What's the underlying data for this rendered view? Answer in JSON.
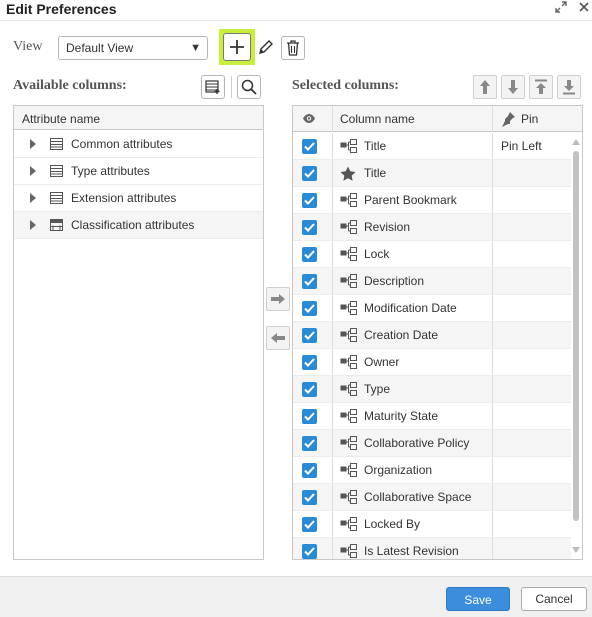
{
  "dialog": {
    "title": "Edit Preferences",
    "expand_icon": "expand-icon",
    "close_icon": "close-icon"
  },
  "view": {
    "label": "View",
    "selected": "Default View",
    "buttons": [
      "add-icon",
      "pencil-icon",
      "trash-icon"
    ]
  },
  "available": {
    "label": "Available columns:",
    "header": "Attribute name",
    "items": [
      {
        "label": "Common attributes",
        "icon": "list-icon"
      },
      {
        "label": "Type attributes",
        "icon": "list-icon"
      },
      {
        "label": "Extension attributes",
        "icon": "list-icon"
      },
      {
        "label": "Classification attributes",
        "icon": "classification-icon"
      }
    ]
  },
  "selected": {
    "label": "Selected columns:",
    "headers": {
      "visible": "eye-icon",
      "column_name": "Column name",
      "pin": "Pin"
    },
    "rows": [
      {
        "name": "Title",
        "icon": "attribute-icon",
        "pin": "Pin Left",
        "checked": true
      },
      {
        "name": "Title",
        "icon": "star-icon",
        "pin": "",
        "checked": true
      },
      {
        "name": "Parent Bookmark",
        "icon": "attribute-icon",
        "pin": "",
        "checked": true
      },
      {
        "name": "Revision",
        "icon": "attribute-icon",
        "pin": "",
        "checked": true
      },
      {
        "name": "Lock",
        "icon": "attribute-icon",
        "pin": "",
        "checked": true
      },
      {
        "name": "Description",
        "icon": "attribute-icon",
        "pin": "",
        "checked": true
      },
      {
        "name": "Modification Date",
        "icon": "attribute-icon",
        "pin": "",
        "checked": true
      },
      {
        "name": "Creation Date",
        "icon": "attribute-icon",
        "pin": "",
        "checked": true
      },
      {
        "name": "Owner",
        "icon": "attribute-icon",
        "pin": "",
        "checked": true
      },
      {
        "name": "Type",
        "icon": "attribute-icon",
        "pin": "",
        "checked": true
      },
      {
        "name": "Maturity State",
        "icon": "attribute-icon",
        "pin": "",
        "checked": true
      },
      {
        "name": "Collaborative Policy",
        "icon": "attribute-icon",
        "pin": "",
        "checked": true
      },
      {
        "name": "Organization",
        "icon": "attribute-icon",
        "pin": "",
        "checked": true
      },
      {
        "name": "Collaborative Space",
        "icon": "attribute-icon",
        "pin": "",
        "checked": true
      },
      {
        "name": "Locked By",
        "icon": "attribute-icon",
        "pin": "",
        "checked": true
      },
      {
        "name": "Is Latest Revision",
        "icon": "attribute-icon",
        "pin": "",
        "checked": true
      }
    ]
  },
  "footer": {
    "save": "Save",
    "cancel": "Cancel"
  },
  "colors": {
    "accent": "#3c8ddc",
    "checkbox": "#2a8ad4",
    "highlight": "#c7ef3c"
  }
}
